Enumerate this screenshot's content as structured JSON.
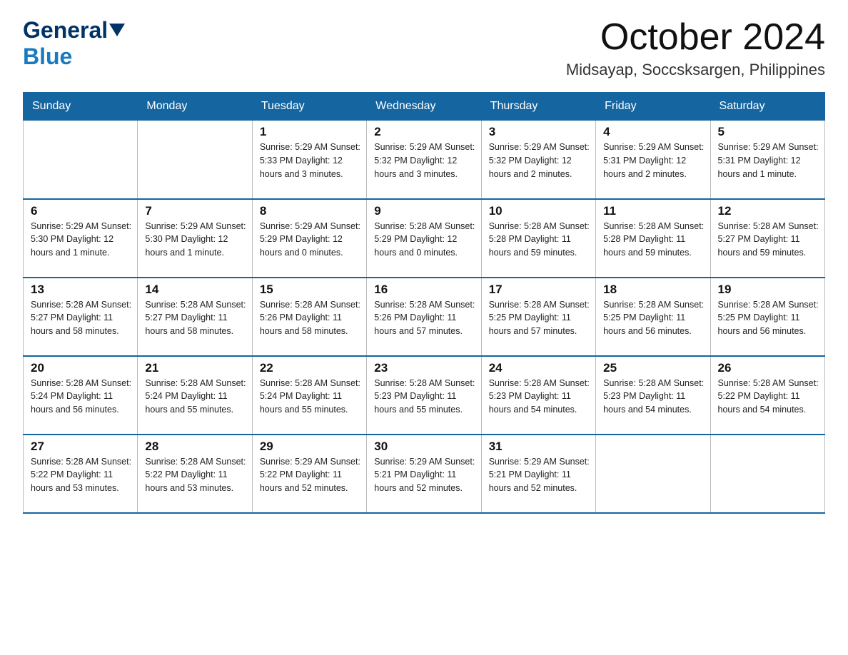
{
  "header": {
    "logo_general": "General",
    "logo_blue": "Blue",
    "month_title": "October 2024",
    "location": "Midsayap, Soccsksargen, Philippines"
  },
  "days_of_week": [
    "Sunday",
    "Monday",
    "Tuesday",
    "Wednesday",
    "Thursday",
    "Friday",
    "Saturday"
  ],
  "weeks": [
    [
      {
        "day": "",
        "info": ""
      },
      {
        "day": "",
        "info": ""
      },
      {
        "day": "1",
        "info": "Sunrise: 5:29 AM\nSunset: 5:33 PM\nDaylight: 12 hours\nand 3 minutes."
      },
      {
        "day": "2",
        "info": "Sunrise: 5:29 AM\nSunset: 5:32 PM\nDaylight: 12 hours\nand 3 minutes."
      },
      {
        "day": "3",
        "info": "Sunrise: 5:29 AM\nSunset: 5:32 PM\nDaylight: 12 hours\nand 2 minutes."
      },
      {
        "day": "4",
        "info": "Sunrise: 5:29 AM\nSunset: 5:31 PM\nDaylight: 12 hours\nand 2 minutes."
      },
      {
        "day": "5",
        "info": "Sunrise: 5:29 AM\nSunset: 5:31 PM\nDaylight: 12 hours\nand 1 minute."
      }
    ],
    [
      {
        "day": "6",
        "info": "Sunrise: 5:29 AM\nSunset: 5:30 PM\nDaylight: 12 hours\nand 1 minute."
      },
      {
        "day": "7",
        "info": "Sunrise: 5:29 AM\nSunset: 5:30 PM\nDaylight: 12 hours\nand 1 minute."
      },
      {
        "day": "8",
        "info": "Sunrise: 5:29 AM\nSunset: 5:29 PM\nDaylight: 12 hours\nand 0 minutes."
      },
      {
        "day": "9",
        "info": "Sunrise: 5:28 AM\nSunset: 5:29 PM\nDaylight: 12 hours\nand 0 minutes."
      },
      {
        "day": "10",
        "info": "Sunrise: 5:28 AM\nSunset: 5:28 PM\nDaylight: 11 hours\nand 59 minutes."
      },
      {
        "day": "11",
        "info": "Sunrise: 5:28 AM\nSunset: 5:28 PM\nDaylight: 11 hours\nand 59 minutes."
      },
      {
        "day": "12",
        "info": "Sunrise: 5:28 AM\nSunset: 5:27 PM\nDaylight: 11 hours\nand 59 minutes."
      }
    ],
    [
      {
        "day": "13",
        "info": "Sunrise: 5:28 AM\nSunset: 5:27 PM\nDaylight: 11 hours\nand 58 minutes."
      },
      {
        "day": "14",
        "info": "Sunrise: 5:28 AM\nSunset: 5:27 PM\nDaylight: 11 hours\nand 58 minutes."
      },
      {
        "day": "15",
        "info": "Sunrise: 5:28 AM\nSunset: 5:26 PM\nDaylight: 11 hours\nand 58 minutes."
      },
      {
        "day": "16",
        "info": "Sunrise: 5:28 AM\nSunset: 5:26 PM\nDaylight: 11 hours\nand 57 minutes."
      },
      {
        "day": "17",
        "info": "Sunrise: 5:28 AM\nSunset: 5:25 PM\nDaylight: 11 hours\nand 57 minutes."
      },
      {
        "day": "18",
        "info": "Sunrise: 5:28 AM\nSunset: 5:25 PM\nDaylight: 11 hours\nand 56 minutes."
      },
      {
        "day": "19",
        "info": "Sunrise: 5:28 AM\nSunset: 5:25 PM\nDaylight: 11 hours\nand 56 minutes."
      }
    ],
    [
      {
        "day": "20",
        "info": "Sunrise: 5:28 AM\nSunset: 5:24 PM\nDaylight: 11 hours\nand 56 minutes."
      },
      {
        "day": "21",
        "info": "Sunrise: 5:28 AM\nSunset: 5:24 PM\nDaylight: 11 hours\nand 55 minutes."
      },
      {
        "day": "22",
        "info": "Sunrise: 5:28 AM\nSunset: 5:24 PM\nDaylight: 11 hours\nand 55 minutes."
      },
      {
        "day": "23",
        "info": "Sunrise: 5:28 AM\nSunset: 5:23 PM\nDaylight: 11 hours\nand 55 minutes."
      },
      {
        "day": "24",
        "info": "Sunrise: 5:28 AM\nSunset: 5:23 PM\nDaylight: 11 hours\nand 54 minutes."
      },
      {
        "day": "25",
        "info": "Sunrise: 5:28 AM\nSunset: 5:23 PM\nDaylight: 11 hours\nand 54 minutes."
      },
      {
        "day": "26",
        "info": "Sunrise: 5:28 AM\nSunset: 5:22 PM\nDaylight: 11 hours\nand 54 minutes."
      }
    ],
    [
      {
        "day": "27",
        "info": "Sunrise: 5:28 AM\nSunset: 5:22 PM\nDaylight: 11 hours\nand 53 minutes."
      },
      {
        "day": "28",
        "info": "Sunrise: 5:28 AM\nSunset: 5:22 PM\nDaylight: 11 hours\nand 53 minutes."
      },
      {
        "day": "29",
        "info": "Sunrise: 5:29 AM\nSunset: 5:22 PM\nDaylight: 11 hours\nand 52 minutes."
      },
      {
        "day": "30",
        "info": "Sunrise: 5:29 AM\nSunset: 5:21 PM\nDaylight: 11 hours\nand 52 minutes."
      },
      {
        "day": "31",
        "info": "Sunrise: 5:29 AM\nSunset: 5:21 PM\nDaylight: 11 hours\nand 52 minutes."
      },
      {
        "day": "",
        "info": ""
      },
      {
        "day": "",
        "info": ""
      }
    ]
  ]
}
